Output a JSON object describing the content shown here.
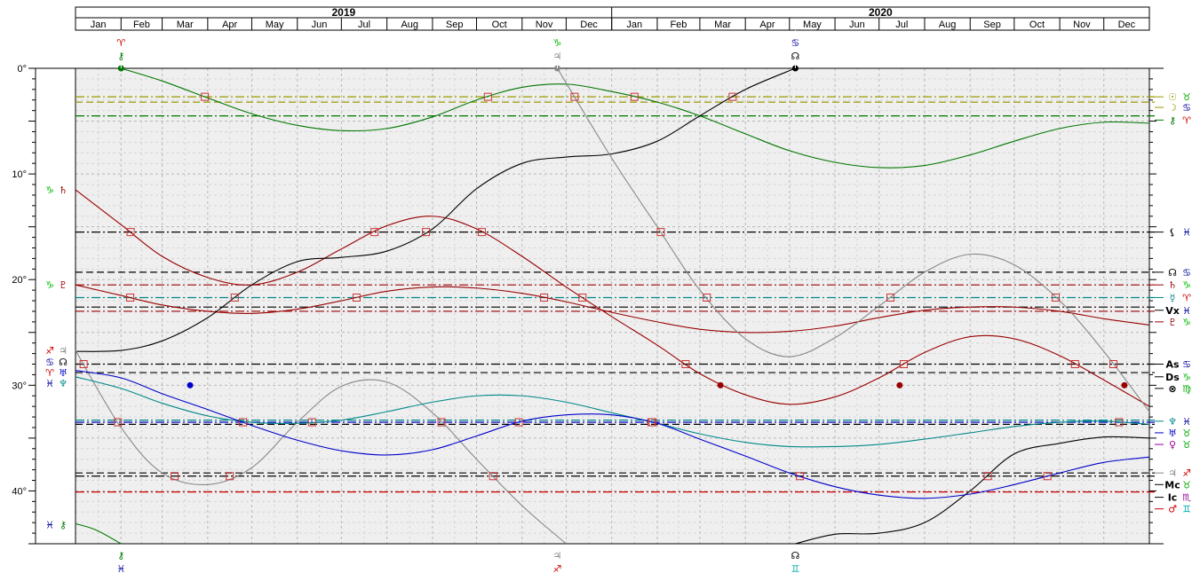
{
  "chart_data": {
    "type": "line",
    "x_axis": {
      "years": [
        {
          "label": "2019",
          "from": "2019-01-01",
          "to": "2020-01-01"
        },
        {
          "label": "2020",
          "from": "2020-01-01",
          "to": "2021-01-01"
        }
      ],
      "months": [
        "Jan",
        "Feb",
        "Mar",
        "Apr",
        "May",
        "Jun",
        "Jul",
        "Aug",
        "Sep",
        "Oct",
        "Nov",
        "Dec"
      ],
      "range": [
        "2019-01-01",
        "2021-01-01"
      ]
    },
    "y_axis": {
      "range": [
        0,
        45
      ],
      "ticks": [
        0,
        10,
        20,
        30,
        40
      ],
      "tick_labels": [
        "0°",
        "10°",
        "20°",
        "30°",
        "40°"
      ]
    },
    "grid": true,
    "colors": {
      "chiron": "#007700",
      "saturn": "#990000",
      "pluto": "#990000",
      "node": "#000000",
      "jupiter": "#888888",
      "neptune": "#008888",
      "uranus": "#0000cc",
      "sun": "#999900",
      "moon": "#999900",
      "lilith": "#000000",
      "mars": "#cc0000",
      "aspect_marker": "#cc3333"
    },
    "top_markers": [
      {
        "x": "2019-02-01",
        "glyphs": [
          "♈",
          "⚷"
        ],
        "colors": [
          "#cc0000",
          "#007700"
        ]
      },
      {
        "x": "2019-11-25",
        "glyphs": [
          "♑",
          "♃"
        ],
        "colors": [
          "#00bb00",
          "#888888"
        ]
      },
      {
        "x": "2020-05-05",
        "glyphs": [
          "♋",
          "☊"
        ],
        "colors": [
          "#000099",
          "#000000"
        ]
      }
    ],
    "bottom_markers": [
      {
        "x": "2019-02-01",
        "glyphs": [
          "⚷",
          "♓"
        ],
        "colors": [
          "#007700",
          "#000099"
        ]
      },
      {
        "x": "2019-11-25",
        "glyphs": [
          "♃",
          "♐"
        ],
        "colors": [
          "#888888",
          "#cc0000"
        ]
      },
      {
        "x": "2020-05-05",
        "glyphs": [
          "☊",
          "♊"
        ],
        "colors": [
          "#000000",
          "#00aaaa"
        ]
      }
    ],
    "left_labels": [
      {
        "y": 11.5,
        "glyphs": [
          "♑",
          "♄"
        ],
        "colors": [
          "#00bb00",
          "#990000"
        ]
      },
      {
        "y": 20.5,
        "glyphs": [
          "♑",
          "♇"
        ],
        "colors": [
          "#00bb00",
          "#990000"
        ]
      },
      {
        "y": 26.7,
        "glyphs": [
          "♐",
          "♃"
        ],
        "colors": [
          "#cc0000",
          "#888888"
        ]
      },
      {
        "y": 27.8,
        "glyphs": [
          "♋",
          "☊"
        ],
        "colors": [
          "#000099",
          "#000000"
        ]
      },
      {
        "y": 28.8,
        "glyphs": [
          "♈",
          "♅"
        ],
        "colors": [
          "#cc0000",
          "#0000cc"
        ]
      },
      {
        "y": 29.8,
        "glyphs": [
          "♓",
          "♆"
        ],
        "colors": [
          "#000099",
          "#008888"
        ]
      },
      {
        "y": 43.2,
        "glyphs": [
          "♓",
          "⚷"
        ],
        "colors": [
          "#000099",
          "#007700"
        ]
      }
    ],
    "right_labels": [
      {
        "y": 2.7,
        "glyphs": [
          "☉",
          "♉"
        ],
        "colors": [
          "#999900",
          "#00aa00"
        ]
      },
      {
        "y": 3.7,
        "glyphs": [
          "☽",
          "♋"
        ],
        "colors": [
          "#999900",
          "#000099"
        ]
      },
      {
        "y": 4.9,
        "glyphs": [
          "⚷",
          "♈"
        ],
        "colors": [
          "#007700",
          "#cc0000"
        ]
      },
      {
        "y": 15.5,
        "glyphs": [
          "⚸",
          "♓"
        ],
        "colors": [
          "#000000",
          "#000099"
        ]
      },
      {
        "y": 19.3,
        "glyphs": [
          "☊",
          "♋"
        ],
        "colors": [
          "#000000",
          "#000099"
        ]
      },
      {
        "y": 20.5,
        "glyphs": [
          "♄",
          "♑"
        ],
        "colors": [
          "#990000",
          "#00bb00"
        ]
      },
      {
        "y": 21.7,
        "glyphs": [
          "☿",
          "♈"
        ],
        "colors": [
          "#008888",
          "#cc0000"
        ]
      },
      {
        "y": 22.9,
        "glyphs": [
          "Vx",
          "♓"
        ],
        "colors": [
          "#000000",
          "#000099"
        ]
      },
      {
        "y": 24.0,
        "glyphs": [
          "♇",
          "♑"
        ],
        "colors": [
          "#990000",
          "#00bb00"
        ]
      },
      {
        "y": 28.0,
        "glyphs": [
          "As",
          "♋"
        ],
        "colors": [
          "#000000",
          "#000099"
        ]
      },
      {
        "y": 29.2,
        "glyphs": [
          "Ds",
          "♑"
        ],
        "colors": [
          "#000000",
          "#00bb00"
        ]
      },
      {
        "y": 30.3,
        "glyphs": [
          "⊗",
          "♍"
        ],
        "colors": [
          "#000000",
          "#00aa00"
        ]
      },
      {
        "y": 33.4,
        "glyphs": [
          "♆",
          "♓"
        ],
        "colors": [
          "#008888",
          "#000099"
        ]
      },
      {
        "y": 34.5,
        "glyphs": [
          "♅",
          "♉"
        ],
        "colors": [
          "#0000cc",
          "#00aa00"
        ]
      },
      {
        "y": 35.6,
        "glyphs": [
          "♀",
          "♉"
        ],
        "colors": [
          "#990099",
          "#00aa00"
        ]
      },
      {
        "y": 38.3,
        "glyphs": [
          "♃",
          "♐"
        ],
        "colors": [
          "#888888",
          "#cc0000"
        ]
      },
      {
        "y": 39.4,
        "glyphs": [
          "Mc",
          "♉"
        ],
        "colors": [
          "#000000",
          "#00aa00"
        ]
      },
      {
        "y": 40.6,
        "glyphs": [
          "Ic",
          "♏"
        ],
        "colors": [
          "#000000",
          "#990099"
        ]
      },
      {
        "y": 41.7,
        "glyphs": [
          "♂",
          "♊"
        ],
        "colors": [
          "#cc0000",
          "#00aaaa"
        ]
      }
    ],
    "horizontal_lines": [
      {
        "y": 2.7,
        "color": "#999900",
        "style": "dashdot"
      },
      {
        "y": 3.2,
        "color": "#999900",
        "style": "dash"
      },
      {
        "y": 4.5,
        "color": "#007700",
        "style": "dashdot"
      },
      {
        "y": 15.5,
        "color": "#000000",
        "style": "dashdot"
      },
      {
        "y": 19.3,
        "color": "#000000",
        "style": "dash"
      },
      {
        "y": 20.5,
        "color": "#990000",
        "style": "dashdot"
      },
      {
        "y": 21.7,
        "color": "#008888",
        "style": "dashdot"
      },
      {
        "y": 22.6,
        "color": "#000000",
        "style": "dashdot"
      },
      {
        "y": 23.0,
        "color": "#990000",
        "style": "dashdot"
      },
      {
        "y": 28.0,
        "color": "#000000",
        "style": "dashdot"
      },
      {
        "y": 28.8,
        "color": "#000000",
        "style": "dash"
      },
      {
        "y": 33.3,
        "color": "#008888",
        "style": "dashdot"
      },
      {
        "y": 33.5,
        "color": "#0000cc",
        "style": "dashdot"
      },
      {
        "y": 33.7,
        "color": "#000000",
        "style": "dash"
      },
      {
        "y": 38.3,
        "color": "#000000",
        "style": "dash"
      },
      {
        "y": 38.6,
        "color": "#000000",
        "style": "dashdot"
      },
      {
        "y": 40.1,
        "color": "#cc0000",
        "style": "dashdot"
      }
    ],
    "series": [
      {
        "name": "⚷",
        "key": "chiron",
        "x": [
          "2019-02-01",
          "2019-03-01",
          "2019-04-01",
          "2019-05-01",
          "2019-06-01",
          "2019-07-01",
          "2019-08-01",
          "2019-09-01",
          "2019-10-01",
          "2019-11-01",
          "2019-12-01",
          "2020-01-01",
          "2020-02-01",
          "2020-03-01",
          "2020-04-01",
          "2020-05-01",
          "2020-06-01",
          "2020-07-01",
          "2020-08-01",
          "2020-09-01",
          "2020-10-01",
          "2020-11-01",
          "2020-12-01",
          "2021-01-01"
        ],
        "y": [
          0.0,
          1.2,
          2.8,
          4.3,
          5.4,
          5.9,
          5.7,
          4.6,
          3.0,
          1.8,
          1.5,
          2.2,
          3.2,
          4.5,
          6.2,
          7.8,
          8.9,
          9.4,
          9.2,
          8.2,
          6.9,
          5.7,
          5.1,
          5.2
        ]
      },
      {
        "name": "⚷",
        "key": "chiron2",
        "x": [
          "2019-01-01",
          "2019-01-15",
          "2019-02-01"
        ],
        "y": [
          43.1,
          43.7,
          45.0
        ]
      },
      {
        "name": "♄",
        "key": "saturn",
        "x": [
          "2019-01-01",
          "2019-02-01",
          "2019-03-01",
          "2019-04-01",
          "2019-05-01",
          "2019-06-01",
          "2019-07-01",
          "2019-08-01",
          "2019-09-01",
          "2019-10-01",
          "2019-11-01",
          "2019-12-01",
          "2020-01-01",
          "2020-02-01",
          "2020-03-01",
          "2020-04-01",
          "2020-05-01",
          "2020-06-01",
          "2020-07-01",
          "2020-08-01",
          "2020-09-01",
          "2020-10-01",
          "2020-11-01",
          "2020-12-01",
          "2021-01-01"
        ],
        "y": [
          11.5,
          14.8,
          17.8,
          19.8,
          20.5,
          19.3,
          17.1,
          14.9,
          14.0,
          15.2,
          17.8,
          20.7,
          23.5,
          26.2,
          28.9,
          30.9,
          31.8,
          31.1,
          29.3,
          26.9,
          25.4,
          25.6,
          27.2,
          29.5,
          32.0
        ]
      },
      {
        "name": "♇",
        "key": "pluto",
        "x": [
          "2019-01-01",
          "2019-02-01",
          "2019-03-01",
          "2019-04-01",
          "2019-05-01",
          "2019-06-01",
          "2019-07-01",
          "2019-08-01",
          "2019-09-01",
          "2019-10-01",
          "2019-11-01",
          "2019-12-01",
          "2020-01-01",
          "2020-02-01",
          "2020-03-01",
          "2020-04-01",
          "2020-05-01",
          "2020-06-01",
          "2020-07-01",
          "2020-08-01",
          "2020-09-01",
          "2020-10-01",
          "2020-11-01",
          "2020-12-01",
          "2021-01-01"
        ],
        "y": [
          20.5,
          21.5,
          22.4,
          23.0,
          23.2,
          22.8,
          22.0,
          21.1,
          20.7,
          20.8,
          21.3,
          22.1,
          23.1,
          24.0,
          24.7,
          25.0,
          24.9,
          24.4,
          23.6,
          22.9,
          22.6,
          22.6,
          23.0,
          23.7,
          24.3
        ]
      },
      {
        "name": "☊",
        "key": "node",
        "x": [
          "2019-01-01",
          "2019-02-01",
          "2019-03-01",
          "2019-04-01",
          "2019-05-01",
          "2019-06-01",
          "2019-07-01",
          "2019-08-01",
          "2019-09-01",
          "2019-10-01",
          "2019-11-01",
          "2019-12-01",
          "2020-01-01",
          "2020-02-01",
          "2020-03-01",
          "2020-04-01",
          "2020-05-05"
        ],
        "y": [
          26.8,
          26.7,
          25.8,
          23.6,
          20.5,
          18.3,
          17.9,
          17.3,
          15.2,
          11.4,
          9.0,
          8.4,
          8.1,
          6.9,
          4.5,
          2.0,
          0.0
        ]
      },
      {
        "name": "☊",
        "key": "node2",
        "x": [
          "2020-05-05",
          "2020-06-01",
          "2020-07-01",
          "2020-08-01",
          "2020-09-01",
          "2020-10-01",
          "2020-11-01",
          "2020-12-01",
          "2021-01-01"
        ],
        "y": [
          45.0,
          44.1,
          44.0,
          43.0,
          40.0,
          36.5,
          35.5,
          34.9,
          35.0
        ]
      },
      {
        "name": "♃",
        "key": "jupiter",
        "x": [
          "2019-01-01",
          "2019-02-01",
          "2019-03-01",
          "2019-04-01",
          "2019-05-01",
          "2019-06-01",
          "2019-07-01",
          "2019-08-01",
          "2019-09-01",
          "2019-10-01",
          "2019-11-01",
          "2019-12-01"
        ],
        "y": [
          26.7,
          34.0,
          38.3,
          39.4,
          37.8,
          33.5,
          30.1,
          29.7,
          32.6,
          37.0,
          41.4,
          45.0
        ]
      },
      {
        "name": "♃",
        "key": "jupiter2",
        "x": [
          "2019-11-25",
          "2020-01-01",
          "2020-02-01",
          "2020-03-01",
          "2020-04-01",
          "2020-05-01",
          "2020-06-01",
          "2020-07-01",
          "2020-08-01",
          "2020-09-01",
          "2020-10-01",
          "2020-11-01",
          "2020-12-01",
          "2021-01-01"
        ],
        "y": [
          0.0,
          8.5,
          15.0,
          21.0,
          25.6,
          27.3,
          25.5,
          22.5,
          19.3,
          17.6,
          18.6,
          22.0,
          26.8,
          32.5
        ]
      },
      {
        "name": "♆",
        "key": "neptune",
        "x": [
          "2019-01-01",
          "2019-02-01",
          "2019-03-01",
          "2019-04-01",
          "2019-05-01",
          "2019-06-01",
          "2019-07-01",
          "2019-08-01",
          "2019-09-01",
          "2019-10-01",
          "2019-11-01",
          "2019-12-01",
          "2020-01-01",
          "2020-02-01",
          "2020-03-01",
          "2020-04-01",
          "2020-05-01",
          "2020-06-01",
          "2020-07-01",
          "2020-08-01",
          "2020-09-01",
          "2020-10-01",
          "2020-11-01",
          "2020-12-01",
          "2021-01-01"
        ],
        "y": [
          29.2,
          30.3,
          31.7,
          32.9,
          33.5,
          33.6,
          33.3,
          32.5,
          31.6,
          31.0,
          31.0,
          31.6,
          32.6,
          33.6,
          34.6,
          35.4,
          35.8,
          35.8,
          35.6,
          35.1,
          34.5,
          33.9,
          33.5,
          33.4,
          33.7
        ]
      },
      {
        "name": "♅",
        "key": "uranus",
        "x": [
          "2019-01-01",
          "2019-02-01",
          "2019-03-01",
          "2019-04-01",
          "2019-05-01",
          "2019-06-01",
          "2019-07-01",
          "2019-08-01",
          "2019-09-01",
          "2019-10-01",
          "2019-11-01",
          "2019-12-01",
          "2020-01-01",
          "2020-02-01",
          "2020-03-01",
          "2020-04-01",
          "2020-05-01",
          "2020-06-01",
          "2020-07-01",
          "2020-08-01",
          "2020-09-01",
          "2020-10-01",
          "2020-11-01",
          "2020-12-01",
          "2021-01-01"
        ],
        "y": [
          28.6,
          29.3,
          30.8,
          32.3,
          33.8,
          35.2,
          36.2,
          36.6,
          36.1,
          34.8,
          33.4,
          32.8,
          32.8,
          33.6,
          35.1,
          36.7,
          38.3,
          39.6,
          40.4,
          40.7,
          40.3,
          39.4,
          38.3,
          37.3,
          36.8
        ]
      }
    ],
    "points": [
      {
        "series": "chiron",
        "x": "2019-02-01",
        "y": 0.0
      },
      {
        "series": "jupiter",
        "x": "2019-11-25",
        "y": 0.0
      },
      {
        "series": "node",
        "x": "2020-05-05",
        "y": 0.0
      },
      {
        "series": "uranus",
        "x": "2019-03-20",
        "y": 30.0
      },
      {
        "series": "saturn",
        "x": "2020-03-15",
        "y": 30.0
      },
      {
        "series": "saturn",
        "x": "2020-07-15",
        "y": 30.0
      },
      {
        "series": "saturn",
        "x": "2020-12-15",
        "y": 30.0
      }
    ]
  }
}
